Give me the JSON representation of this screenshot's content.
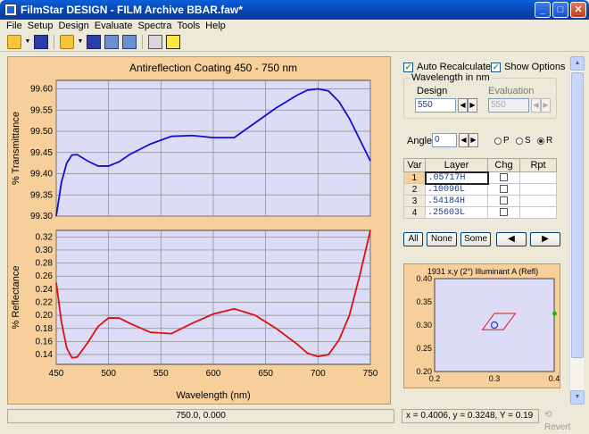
{
  "window": {
    "title": "FilmStar DESIGN - FILM Archive BBAR.faw*"
  },
  "menu": [
    "File",
    "Setup",
    "Design",
    "Evaluate",
    "Spectra",
    "Tools",
    "Help"
  ],
  "controls": {
    "auto_recalculate": {
      "label": "Auto Recalculate",
      "checked": true
    },
    "show_options": {
      "label": "Show Options",
      "checked": true
    },
    "wavelength_group": "Wavelength in nm",
    "design_label": "Design",
    "design_value": "550",
    "evaluation_label": "Evaluation",
    "evaluation_value": "550",
    "angle_label": "Angle",
    "angle_value": "0",
    "polarization": [
      {
        "label": "P",
        "selected": false
      },
      {
        "label": "S",
        "selected": false
      },
      {
        "label": "R",
        "selected": true
      }
    ]
  },
  "layer_table": {
    "headers": [
      "Var",
      "Layer",
      "Chg",
      "Rpt"
    ],
    "rows": [
      {
        "num": "1",
        "layer": ".05717H"
      },
      {
        "num": "2",
        "layer": ".10096L"
      },
      {
        "num": "3",
        "layer": ".54184H"
      },
      {
        "num": "4",
        "layer": ".25603L"
      }
    ]
  },
  "buttons": {
    "all": "All",
    "none": "None",
    "some": "Some",
    "prev": "◀",
    "next": "▶"
  },
  "status": {
    "cursor": "750.0, 0.000",
    "readout": "x = 0.4006, y = 0.3248, Y = 0.19",
    "revert": "Revert"
  },
  "colors": {
    "plot_bg": "#dcdcf6",
    "panel_bg": "#f7cf9a",
    "transmittance": "#1010d0",
    "reflectance": "#dd1010"
  },
  "chart_data": [
    {
      "type": "line",
      "title": "Antireflection Coating 450 - 750 nm",
      "xlabel": "",
      "ylabel": "% Transmittance",
      "xlim": [
        450,
        750
      ],
      "ylim": [
        99.3,
        99.62
      ],
      "yticks": [
        "99.30",
        "99.35",
        "99.40",
        "99.45",
        "99.50",
        "99.55",
        "99.60"
      ],
      "xticks": [
        "450",
        "500",
        "550",
        "600",
        "650",
        "700",
        "750"
      ],
      "grid": true,
      "series": [
        {
          "x": [
            450,
            455,
            460,
            465,
            470,
            480,
            490,
            500,
            510,
            520,
            540,
            560,
            580,
            600,
            620,
            640,
            660,
            680,
            690,
            700,
            710,
            720,
            730,
            740,
            750
          ],
          "y": [
            99.3,
            99.38,
            99.425,
            99.444,
            99.445,
            99.43,
            99.418,
            99.418,
            99.428,
            99.445,
            99.47,
            99.488,
            99.49,
            99.485,
            99.485,
            99.52,
            99.555,
            99.585,
            99.597,
            99.6,
            99.595,
            99.57,
            99.53,
            99.48,
            99.43
          ]
        }
      ]
    },
    {
      "type": "line",
      "title": "",
      "xlabel": "Wavelength (nm)",
      "ylabel": "% Reflectance",
      "xlim": [
        450,
        750
      ],
      "ylim": [
        0.125,
        0.33
      ],
      "yticks": [
        "0.14",
        "0.16",
        "0.18",
        "0.20",
        "0.22",
        "0.24",
        "0.26",
        "0.28",
        "0.30",
        "0.32"
      ],
      "xticks": [
        "450",
        "500",
        "550",
        "600",
        "650",
        "700",
        "750"
      ],
      "grid": true,
      "series": [
        {
          "x": [
            450,
            455,
            460,
            465,
            470,
            480,
            490,
            500,
            510,
            520,
            540,
            560,
            580,
            600,
            620,
            640,
            660,
            680,
            690,
            700,
            710,
            720,
            730,
            740,
            750
          ],
          "y": [
            0.25,
            0.19,
            0.15,
            0.135,
            0.136,
            0.158,
            0.183,
            0.196,
            0.196,
            0.188,
            0.174,
            0.172,
            0.188,
            0.202,
            0.21,
            0.2,
            0.18,
            0.156,
            0.142,
            0.137,
            0.14,
            0.162,
            0.2,
            0.262,
            0.33
          ]
        }
      ]
    },
    {
      "type": "scatter",
      "title": "1931 x,y (2°) Illuminant A (Refl)",
      "xlim": [
        0.2,
        0.4
      ],
      "ylim": [
        0.2,
        0.4
      ],
      "xticks": [
        "0.2",
        "0.3",
        "0.4"
      ],
      "yticks": [
        "0.20",
        "0.25",
        "0.30",
        "0.35",
        "0.40"
      ],
      "target_polygon": [
        [
          0.28,
          0.29
        ],
        [
          0.3,
          0.325
        ],
        [
          0.335,
          0.325
        ],
        [
          0.315,
          0.29
        ]
      ],
      "design_point": [
        0.3,
        0.3
      ],
      "illuminant_point": [
        0.4006,
        0.3248
      ]
    }
  ]
}
